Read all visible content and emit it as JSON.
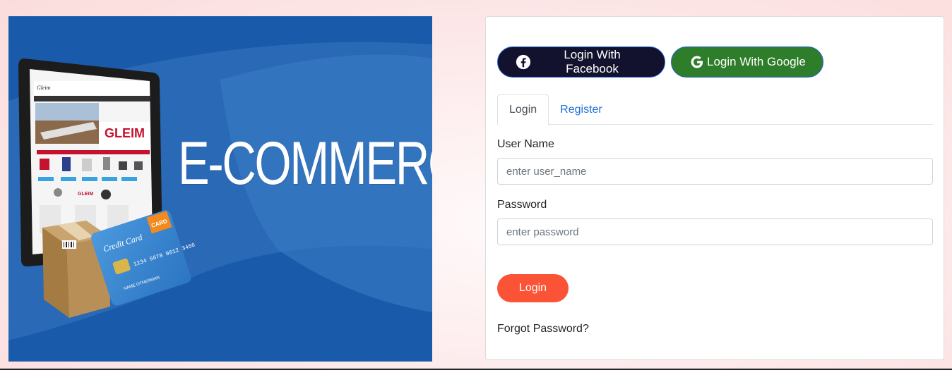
{
  "banner": {
    "title": "E-COMMERCE",
    "screen_brand": "GLEIM",
    "card_label": "Credit Card",
    "card_badge": "CARD",
    "card_number": "1234 5678 9012 3456",
    "card_name": "NAME OTHERMAN",
    "colors": {
      "background": "#1a5aab",
      "band": "#3a78c0"
    }
  },
  "social": {
    "facebook_label": "Login With Facebook",
    "google_label": "Login With Google",
    "facebook_icon": "facebook-icon",
    "google_icon": "google-icon"
  },
  "tabs": [
    {
      "label": "Login",
      "active": true
    },
    {
      "label": "Register",
      "active": false
    }
  ],
  "form": {
    "username_label": "User Name",
    "username_placeholder": "enter user_name",
    "password_label": "Password",
    "password_placeholder": "enter password",
    "submit_label": "Login",
    "forgot_label": "Forgot Password?"
  },
  "colors": {
    "facebook_bg": "#13122e",
    "google_bg": "#2e7d2a",
    "button_border": "#1e5fd8",
    "login_button": "#fb5336",
    "link": "#1e6fd9"
  }
}
